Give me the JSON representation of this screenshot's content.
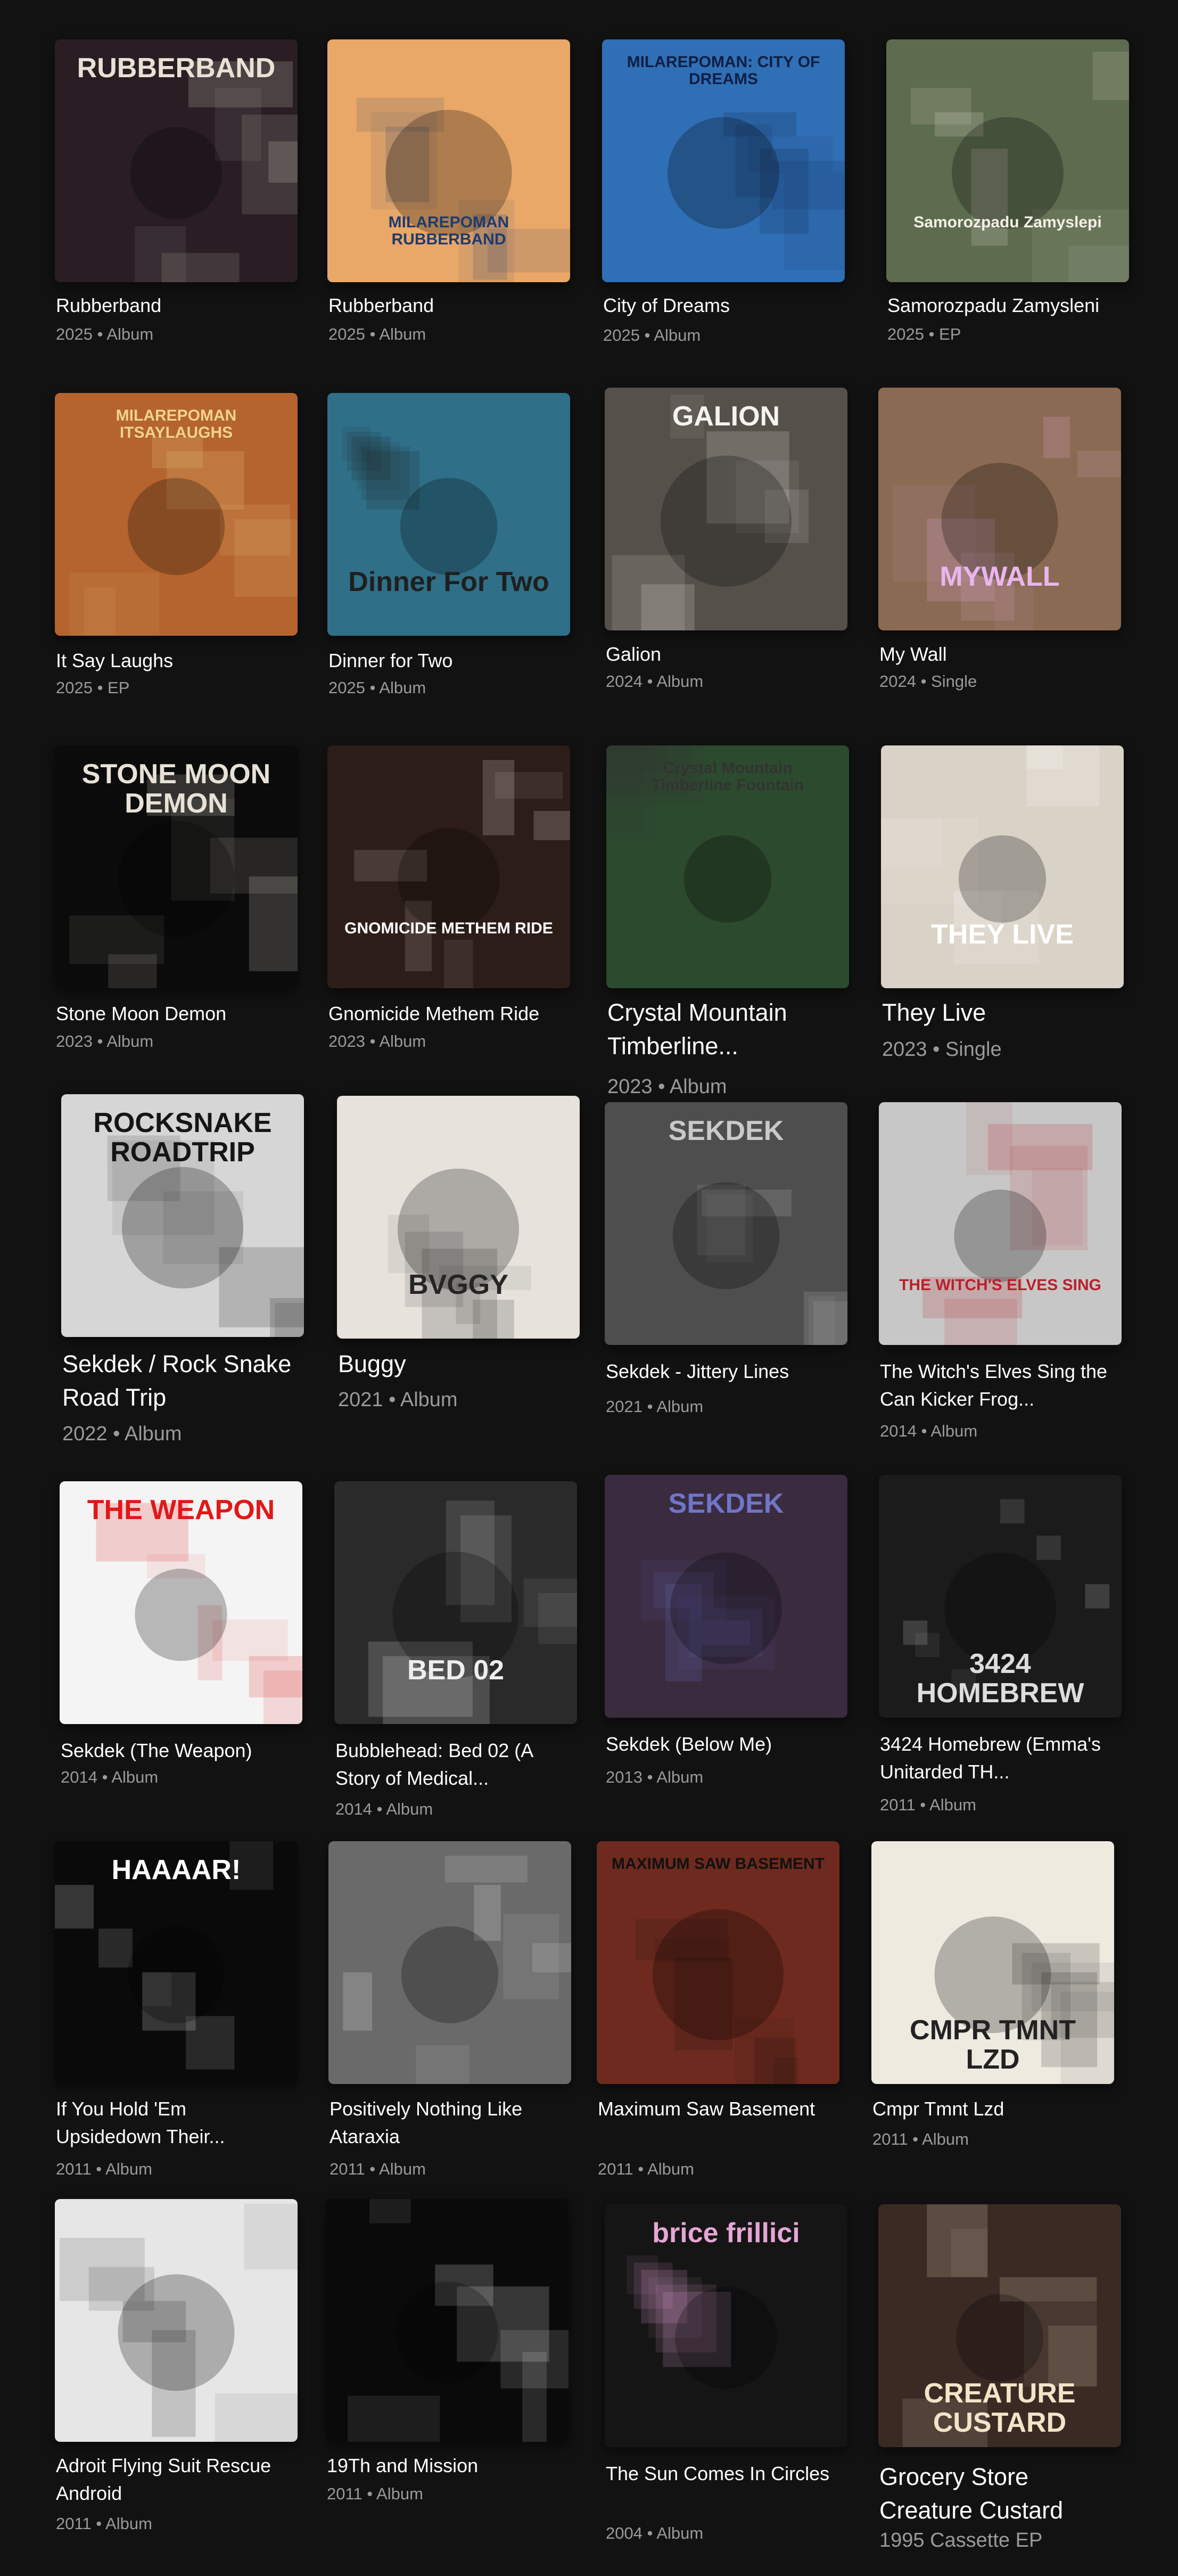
{
  "albums": [
    {
      "title": "Rubberband",
      "meta": "2025 • Album",
      "cover_text": "RUBBERBAND",
      "bg": "#2a1e24",
      "fg": "#e9e2d4"
    },
    {
      "title": "Rubberband",
      "meta": "2025 • Album",
      "cover_text": "MILAREPOMAN RUBBERBAND",
      "bg": "#e9a768",
      "fg": "#1f3b6e"
    },
    {
      "title": "City of Dreams",
      "meta": "2025 • Album",
      "cover_text": "MILAREPOMAN: CITY OF DREAMS",
      "bg": "#2f6fb5",
      "fg": "#0e1f45"
    },
    {
      "title": "Samorozpadu Zamysleni",
      "meta": "2025 • EP",
      "cover_text": "Samorozpadu Zamyslepi",
      "bg": "#5d6b4e",
      "fg": "#f4f1e6"
    },
    {
      "title": "It Say Laughs",
      "meta": "2025 • EP",
      "cover_text": "MILAREPOMAN ITSAYLAUGHS",
      "bg": "#b5642f",
      "fg": "#f0d48a"
    },
    {
      "title": "Dinner for Two",
      "meta": "2025 • Album",
      "cover_text": "Dinner For Two",
      "bg": "#2f6f88",
      "fg": "#1f1f1f"
    },
    {
      "title": "Galion",
      "meta": "2024 • Album",
      "cover_text": "GALION",
      "bg": "#56504a",
      "fg": "#f5f3ef"
    },
    {
      "title": "My Wall",
      "meta": "2024 • Single",
      "cover_text": "MYWALL",
      "bg": "#8a6a52",
      "fg": "#e9b6ee"
    },
    {
      "title": "Stone Moon Demon",
      "meta": "2023 • Album",
      "cover_text": "STONE MOON DEMON",
      "bg": "#0b0b0b",
      "fg": "#e8e2d6"
    },
    {
      "title": "Gnomicide Methem Ride",
      "meta": "2023 • Album",
      "cover_text": "GNOMICIDE METHEM RIDE",
      "bg": "#2d1d18",
      "fg": "#ffffff"
    },
    {
      "title": "Crystal Mountain Timberline...",
      "meta": "2023 • Album",
      "cover_text": "Crystal Mountain Timberline Fountain",
      "bg": "#2c4a2e",
      "fg": "#333333"
    },
    {
      "title": "They Live",
      "meta": "2023 • Single",
      "cover_text": "THEY LIVE",
      "bg": "#d9d2c6",
      "fg": "#ffffff"
    },
    {
      "title": "Sekdek / Rock Snake Road Trip",
      "meta": "2022 • Album",
      "cover_text": "ROCKSNAKE ROADTRIP",
      "bg": "#d6d6d6",
      "fg": "#151515"
    },
    {
      "title": "Buggy",
      "meta": "2021 • Album",
      "cover_text": "BVGGY",
      "bg": "#e7e2dc",
      "fg": "#252525"
    },
    {
      "title": "Sekdek - Jittery Lines",
      "meta": "2021 • Album",
      "cover_text": "SEKDEK",
      "bg": "#4e4e4e",
      "fg": "#c9c9c9"
    },
    {
      "title": "The Witch's Elves Sing the Can Kicker Frog...",
      "meta": "2014 • Album",
      "cover_text": "THE WITCH'S ELVES SING",
      "bg": "#c7c7c7",
      "fg": "#b8212a"
    },
    {
      "title": "Sekdek (The Weapon)",
      "meta": "2014 • Album",
      "cover_text": "THE WEAPON",
      "bg": "#f4f4f4",
      "fg": "#e01818"
    },
    {
      "title": "Bubblehead: Bed 02 (A Story of Medical...",
      "meta": "2014 • Album",
      "cover_text": "BED 02",
      "bg": "#2a2a2a",
      "fg": "#eeeeee"
    },
    {
      "title": "Sekdek (Below Me)",
      "meta": "2013 • Album",
      "cover_text": "SEKDEK",
      "bg": "#3a2b3f",
      "fg": "#6f76c9"
    },
    {
      "title": "3424 Homebrew (Emma's Unitarded TH...",
      "meta": "2011 • Album",
      "cover_text": "3424 HOMEBREW",
      "bg": "#1b1b1b",
      "fg": "#dddddd"
    },
    {
      "title": "If You Hold 'Em Upsidedown Their...",
      "meta": "2011 • Album",
      "cover_text": "HAAAAR!",
      "bg": "#0a0a0a",
      "fg": "#ffffff"
    },
    {
      "title": "Positively Nothing Like Ataraxia",
      "meta": "2011 • Album",
      "cover_text": "",
      "bg": "#6a6a6a",
      "fg": "#ffffff"
    },
    {
      "title": "Maximum Saw Basement",
      "meta": "2011 • Album",
      "cover_text": "MAXIMUM SAW BASEMENT",
      "bg": "#6e2a1e",
      "fg": "#111111"
    },
    {
      "title": "Cmpr Tmnt Lzd",
      "meta": "2011 • Album",
      "cover_text": "CMPR TMNT LZD",
      "bg": "#eeeae0",
      "fg": "#222222"
    },
    {
      "title": "Adroit Flying Suit Rescue Android",
      "meta": "2011 • Album",
      "cover_text": "",
      "bg": "#e6e6e6",
      "fg": "#222222"
    },
    {
      "title": "19Th and Mission",
      "meta": "2011 • Album",
      "cover_text": "",
      "bg": "#0a0a0a",
      "fg": "#ffffff"
    },
    {
      "title": "The Sun Comes In Circles",
      "meta": "2004 • Album",
      "cover_text": "brice frillici",
      "bg": "#151515",
      "fg": "#e6a6d6"
    },
    {
      "title": "Grocery Store Creature Custard",
      "meta": "1995 Cassette EP",
      "cover_text": "CREATURE CUSTARD",
      "bg": "#3b2a24",
      "fg": "#f1e5c8"
    }
  ]
}
